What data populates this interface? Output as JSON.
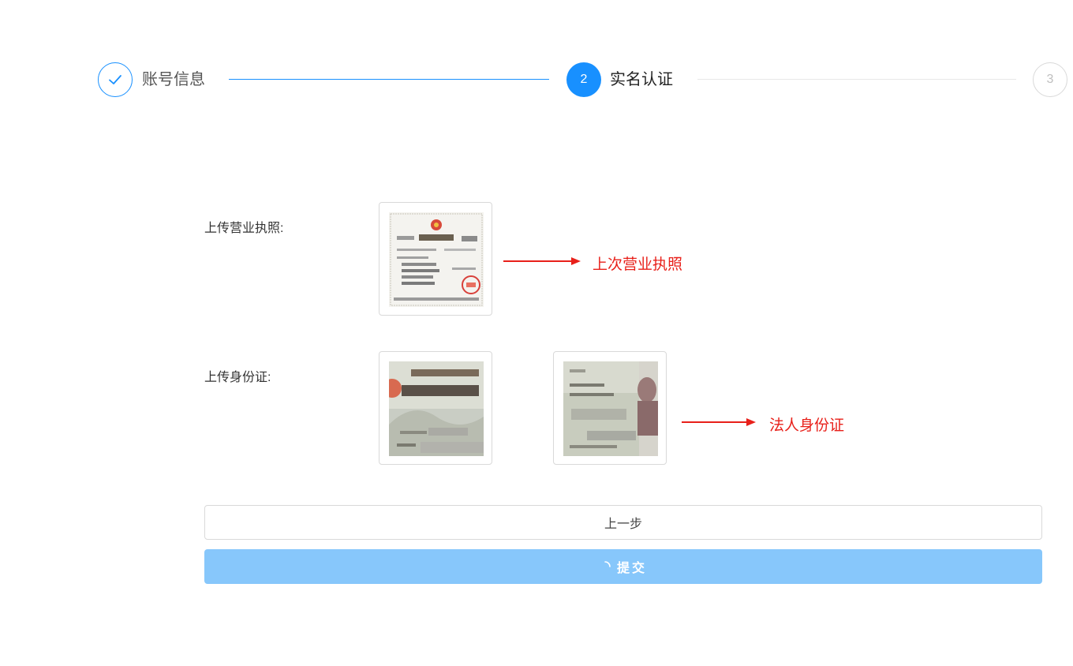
{
  "steps": [
    {
      "number": "1",
      "title": "账号信息",
      "status": "finished"
    },
    {
      "number": "2",
      "title": "实名认证",
      "status": "active"
    },
    {
      "number": "3",
      "title": "",
      "status": "waiting"
    }
  ],
  "form": {
    "license_label": "上传营业执照:",
    "id_label": "上传身份证:"
  },
  "annotations": {
    "license_note": "上次营业执照",
    "id_note": "法人身份证"
  },
  "buttons": {
    "prev_label": "上一步",
    "submit_label": "提交"
  },
  "colors": {
    "primary": "#1890ff",
    "submit_loading_bg": "#87c7fb",
    "annotation": "#e8201a"
  }
}
